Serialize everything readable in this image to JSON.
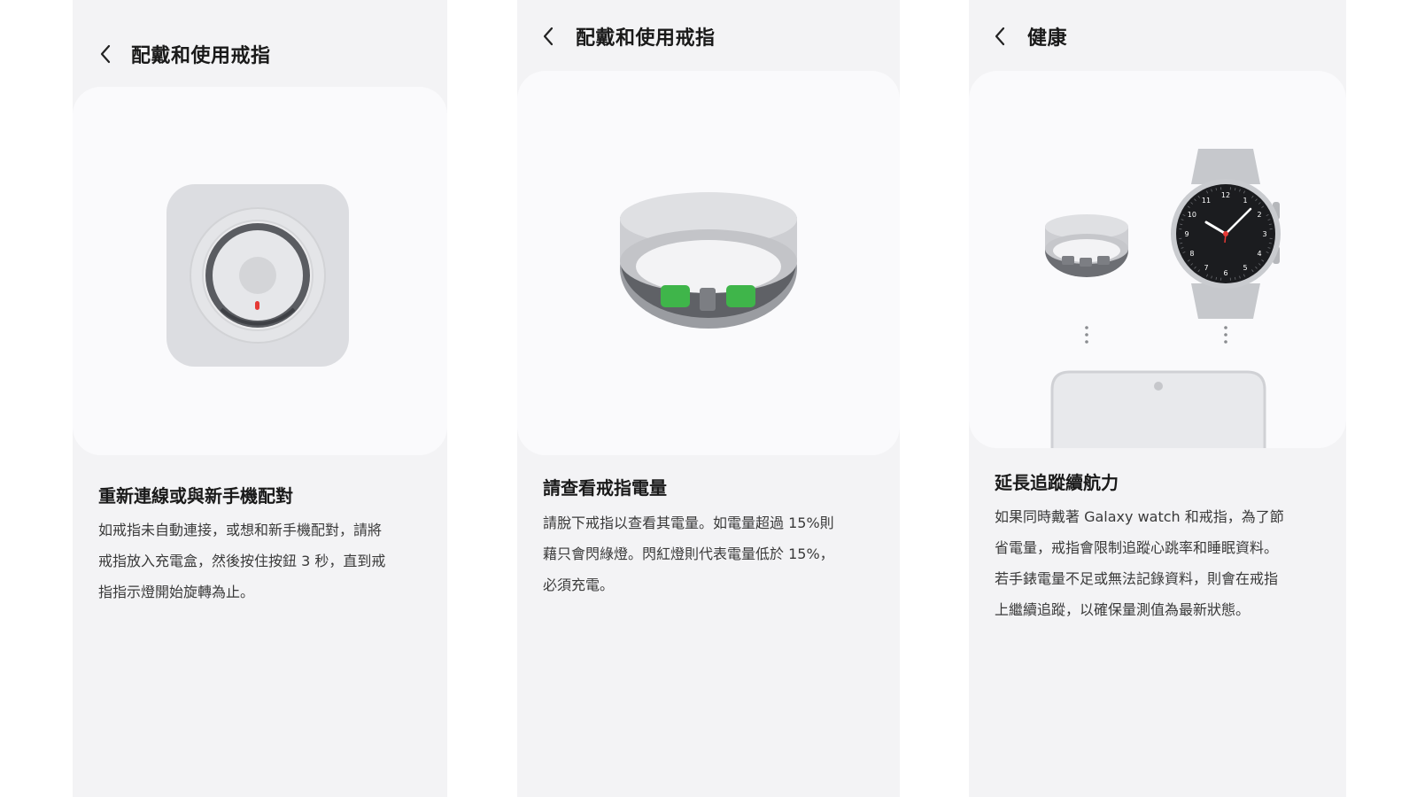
{
  "panels": [
    {
      "title": "配戴和使用戒指",
      "heading": "重新連線或與新手機配對",
      "lines": [
        "如戒指未自動連接，或想和新手機配對，請將",
        "戒指放入充電盒，然後按住按鈕 3 秒，直到戒",
        "指指示燈開始旋轉為止。"
      ]
    },
    {
      "title": "配戴和使用戒指",
      "heading": "請查看戒指電量",
      "lines": [
        "請脫下戒指以查看其電量。如電量超過 15%則",
        "藉只會閃綠燈。閃紅燈則代表電量低於 15%，",
        "必須充電。"
      ]
    },
    {
      "title": "健康",
      "heading": "延長追蹤續航力",
      "lines": [
        "如果同時戴著 Galaxy watch 和戒指，為了節",
        "省電量，戒指會限制追蹤心跳率和睡眠資料。",
        "若手錶電量不足或無法記錄資料，則會在戒指",
        "上繼續追蹤，以確保量測值為最新狀態。"
      ]
    }
  ],
  "watch_numbers": [
    "12",
    "1",
    "2",
    "3",
    "4",
    "5",
    "6",
    "7",
    "8",
    "9",
    "10",
    "11"
  ],
  "icons": {
    "back": "chevron-left-icon",
    "charger": "charging-case-icon",
    "ring": "galaxy-ring-icon",
    "watch": "galaxy-watch-icon",
    "phone": "phone-icon"
  },
  "colors": {
    "panel_bg": "#f3f3f5",
    "card_bg": "#fafafc",
    "sensor_green": "#3fb54a",
    "led_red": "#e53935",
    "second_hand": "#e53935"
  }
}
